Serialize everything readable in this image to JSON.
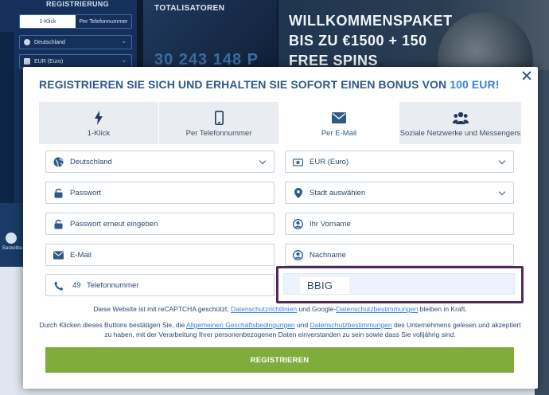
{
  "background": {
    "sidebar_title": "REGISTRIERUNG",
    "sidebar_tabs": [
      "1-Klick",
      "Per Telefonnummer"
    ],
    "sidebar_country": "Deutschland",
    "sidebar_currency": "EUR (Euro)",
    "totalisator_title": "TOTALISATOREN",
    "totalisator_amount": "30 243 148 P",
    "promo_lines": [
      "WILLKOMMENSPAKET",
      "BIS ZU €1500 + 150",
      "FREE SPINS"
    ],
    "basketball_label": "Basketba"
  },
  "modal": {
    "title_prefix": "REGISTRIEREN SIE SICH UND ERHALTEN SIE SOFORT EINEN BONUS VON ",
    "title_bonus": "100 EUR!",
    "tabs": [
      {
        "label": "1-Klick",
        "icon": "lightning-icon"
      },
      {
        "label": "Per Telefonnummer",
        "icon": "smartphone-icon"
      },
      {
        "label": "Per E-Mail",
        "icon": "envelope-icon",
        "active": true
      },
      {
        "label": "Soziale Netzwerke und Messengers",
        "icon": "people-icon"
      }
    ],
    "fields": {
      "country": "Deutschland",
      "currency": "EUR (Euro)",
      "password": "Passwort",
      "city": "Stadt auswählen",
      "password_repeat": "Passwort erneut eingeben",
      "first_name": "Ihr Vorname",
      "email": "E-Mail",
      "last_name": "Nachname",
      "phone_prefix": "49",
      "phone": "Telefonnummer",
      "promo_code": "BBIG"
    },
    "recaptcha": {
      "text_1": "Diese Website ist mit reCAPTCHA geschützt; ",
      "link_1": "Datenschutzrichtlinien",
      "text_2": " und Google-",
      "link_2": "Datenschutzbestimmungen",
      "text_3": " bleiben in Kraft."
    },
    "terms": {
      "text_1": "Durch Klicken dieses Buttons bestätigen Sie, die ",
      "link_1": "Allgemeinen Geschäftsbedingungen",
      "text_2": " und ",
      "link_2": "Datenschutzbestimmungen",
      "text_3": " des Unternehmens gelesen und akzeptiert zu haben, mit der Verarbeitung Ihrer personenbezogenen Daten einverstanden zu sein sowie dass Sie volljährig sind."
    },
    "submit_label": "REGISTRIEREN"
  },
  "colors": {
    "accent": "#3c83d4",
    "title": "#2e5a88",
    "submit": "#7fac3c",
    "promo_border": "#4f2a55"
  }
}
